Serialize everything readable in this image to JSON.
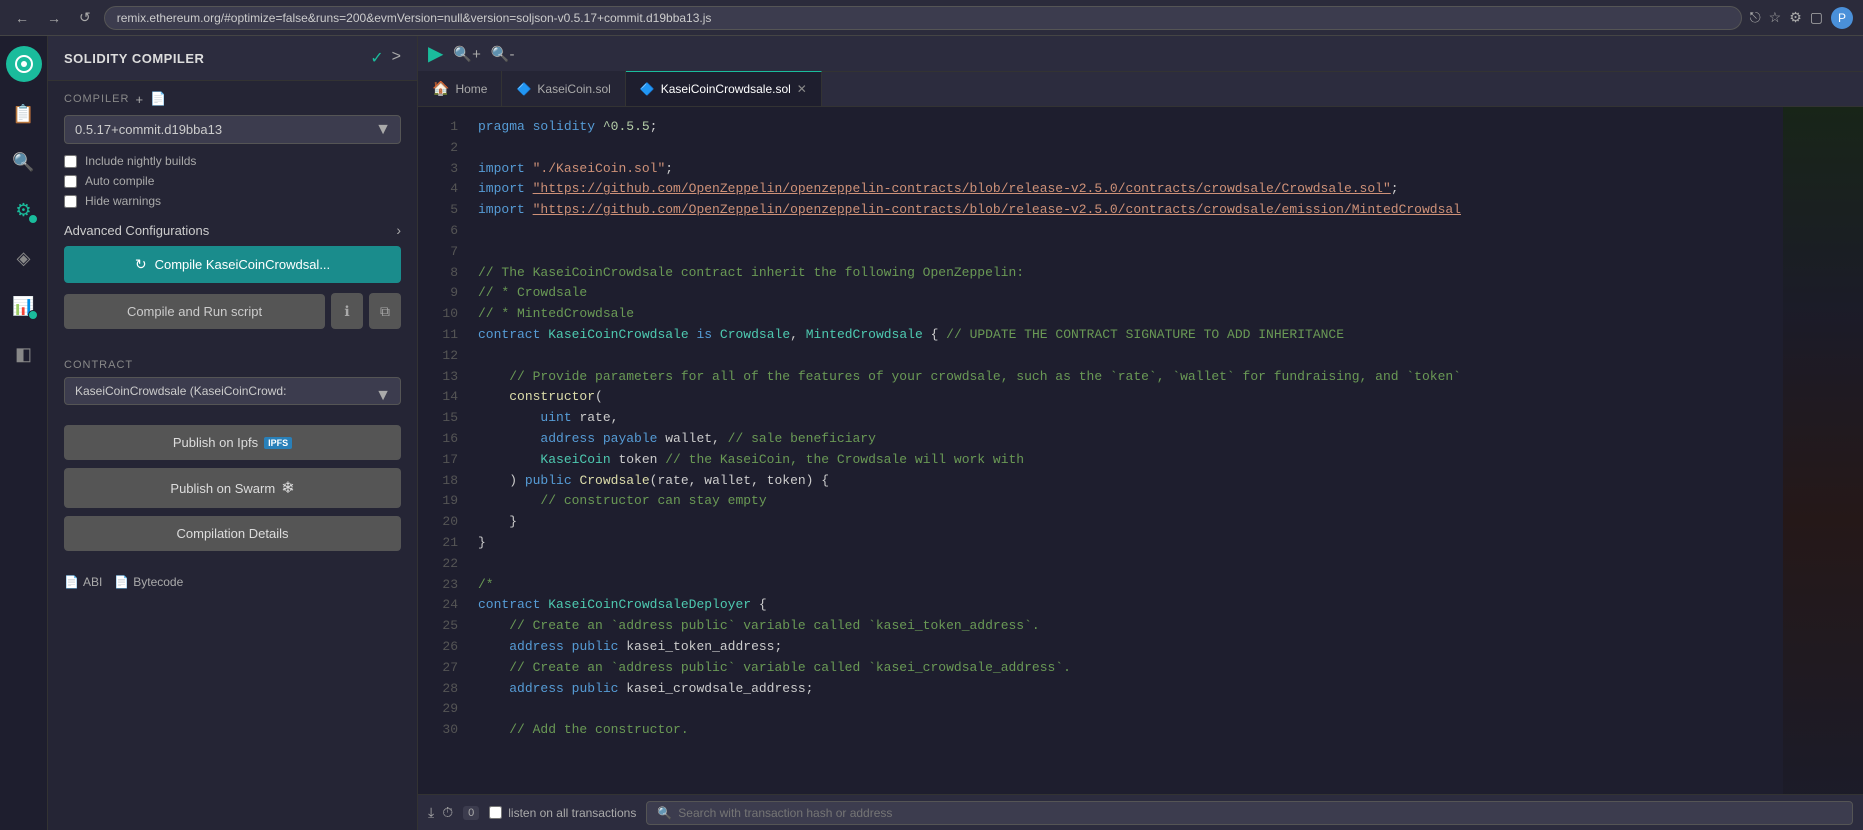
{
  "browser": {
    "back_label": "←",
    "forward_label": "→",
    "reload_label": "↺",
    "url": "remix.ethereum.org/#optimize=false&runs=200&evmVersion=null&version=soljson-v0.5.17+commit.d19bba13.js",
    "share_label": "⎋",
    "star_label": "☆",
    "extensions_label": "⚙",
    "window_label": "▢",
    "profile_label": "P"
  },
  "sidebar": {
    "title": "SOLIDITY COMPILER",
    "check_icon": "✓",
    "settings_icon": ">",
    "compiler_label": "COMPILER",
    "add_icon": "+",
    "file_icon": "📄",
    "compiler_version": "0.5.17+commit.d19bba13",
    "include_nightly": "Include nightly builds",
    "auto_compile": "Auto compile",
    "hide_warnings": "Hide warnings",
    "advanced_config": "Advanced Configurations",
    "compile_btn": "Compile KaseiCoinCrowdsal...",
    "compile_run_btn": "Compile and Run script",
    "info_icon": "ℹ",
    "copy_icon": "⧉",
    "contract_label": "CONTRACT",
    "contract_value": "KaseiCoinCrowdsale (KaseiCoinCrowd:",
    "publish_ipfs": "Publish on Ipfs",
    "ipfs_badge": "IPFS",
    "publish_swarm": "Publish on Swarm",
    "compilation_details": "Compilation Details",
    "abi_label": "ABI",
    "bytecode_label": "Bytecode"
  },
  "tabs": [
    {
      "label": "Home",
      "icon": "🏠",
      "active": false,
      "closeable": false
    },
    {
      "label": "KaseiCoin.sol",
      "icon": "🔷",
      "active": false,
      "closeable": false
    },
    {
      "label": "KaseiCoinCrowdsale.sol",
      "icon": "🔷",
      "active": true,
      "closeable": true
    }
  ],
  "code": {
    "lines": [
      "pragma solidity ^0.5.5;",
      "",
      "import \"./KaseiCoin.sol\";",
      "import \"https://github.com/OpenZeppelin/openzeppelin-contracts/blob/release-v2.5.0/contracts/crowdsale/Crowdsale.sol\";",
      "import \"https://github.com/OpenZeppelin/openzeppelin-contracts/blob/release-v2.5.0/contracts/crowdsale/emission/MintedCrowdsal",
      "",
      "",
      "// The KaseiCoinCrowdsale contract inherit the following OpenZeppelin:",
      "// * Crowdsale",
      "// * MintedCrowdsale",
      "contract KaseiCoinCrowdsale is Crowdsale, MintedCrowdsale { // UPDATE THE CONTRACT SIGNATURE TO ADD INHERITANCE",
      "",
      "    // Provide parameters for all of the features of your crowdsale, such as the `rate`, `wallet` for fundraising, and `token`",
      "    constructor(",
      "        uint rate,",
      "        address payable wallet, // sale beneficiary",
      "        KaseiCoin token // the KaseiCoin, the Crowdsale will work with",
      "    ) public Crowdsale(rate, wallet, token) {",
      "        // constructor can stay empty",
      "    }",
      "}",
      "",
      "/*",
      "contract KaseiCoinCrowdsaleDeployer {",
      "    // Create an `address public` variable called `kasei_token_address`.",
      "    address public kasei_token_address;",
      "    // Create an `address public` variable called `kasei_crowdsale_address`.",
      "    address public kasei_crowdsale_address;",
      "",
      "    // Add the constructor."
    ]
  },
  "bottom": {
    "tx_count": "0",
    "listen_label": "listen on all transactions",
    "search_placeholder": "Search with transaction hash or address"
  },
  "activity_icons": [
    {
      "name": "logo",
      "symbol": "◉",
      "active": true
    },
    {
      "name": "files",
      "symbol": "📋",
      "active": false
    },
    {
      "name": "search",
      "symbol": "🔍",
      "active": false
    },
    {
      "name": "compiler",
      "symbol": "⚙",
      "active": true,
      "badge": true
    },
    {
      "name": "deploy",
      "symbol": "◈",
      "active": false
    },
    {
      "name": "analytics",
      "symbol": "📊",
      "active": false,
      "badge": true
    },
    {
      "name": "plugins",
      "symbol": "◧",
      "active": false
    }
  ]
}
